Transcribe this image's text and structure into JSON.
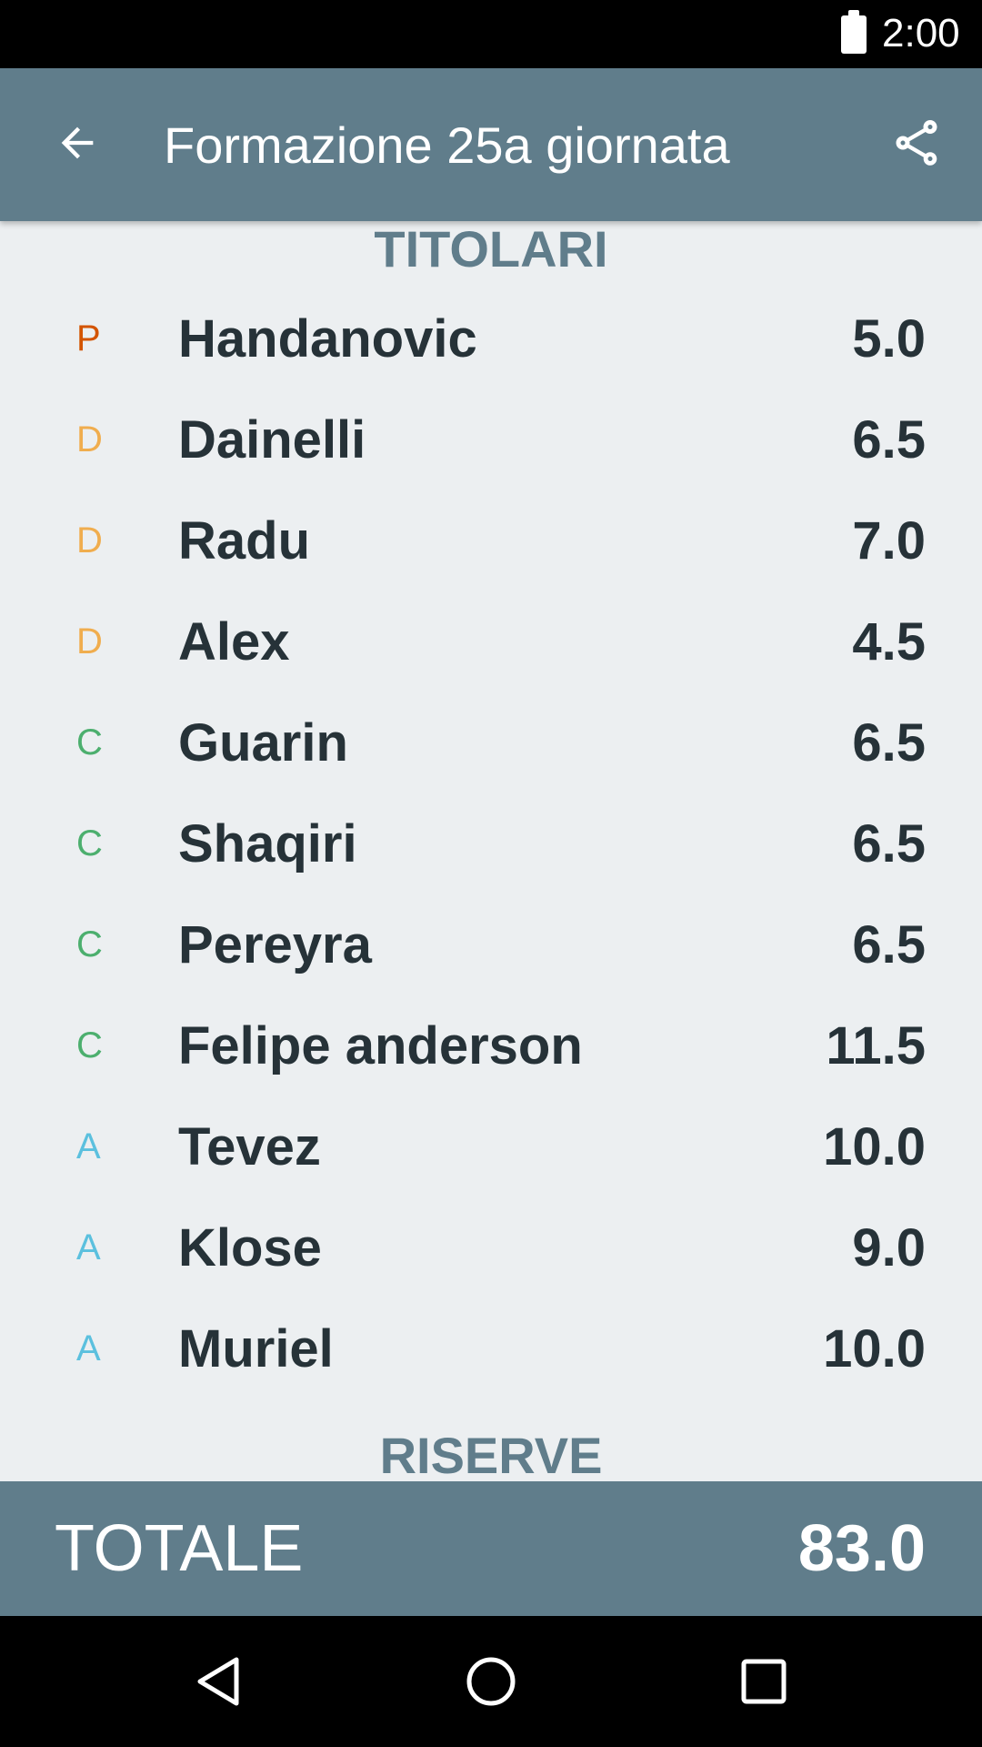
{
  "status_bar": {
    "time": "2:00"
  },
  "app_bar": {
    "title": "Formazione 25a giornata",
    "back_icon": "arrow-back-icon",
    "share_icon": "share-icon"
  },
  "sections": {
    "starters_title": "TITOLARI",
    "reserves_title": "RISERVE"
  },
  "role_colors": {
    "P": "#d35400",
    "D": "#f0ad4e",
    "C": "#4caf6e",
    "A": "#5bc0de"
  },
  "players": [
    {
      "role": "P",
      "name": "Handanovic",
      "score": "5.0"
    },
    {
      "role": "D",
      "name": "Dainelli",
      "score": "6.5"
    },
    {
      "role": "D",
      "name": "Radu",
      "score": "7.0"
    },
    {
      "role": "D",
      "name": "Alex",
      "score": "4.5"
    },
    {
      "role": "C",
      "name": "Guarin",
      "score": "6.5"
    },
    {
      "role": "C",
      "name": "Shaqiri",
      "score": "6.5"
    },
    {
      "role": "C",
      "name": "Pereyra",
      "score": "6.5"
    },
    {
      "role": "C",
      "name": "Felipe anderson",
      "score": "11.5"
    },
    {
      "role": "A",
      "name": "Tevez",
      "score": "10.0"
    },
    {
      "role": "A",
      "name": "Klose",
      "score": "9.0"
    },
    {
      "role": "A",
      "name": "Muriel",
      "score": "10.0"
    }
  ],
  "total": {
    "label": "TOTALE",
    "value": "83.0"
  },
  "nav_bar": {
    "back_icon": "nav-back-icon",
    "home_icon": "nav-home-icon",
    "recents_icon": "nav-recents-icon"
  }
}
